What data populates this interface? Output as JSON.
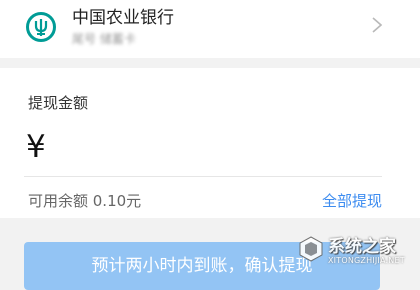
{
  "bank_card": {
    "name": "中国农业银行",
    "subtitle": "尾号 储蓄卡",
    "brand_color": "#009c96"
  },
  "withdraw": {
    "title": "提现金额",
    "currency_symbol": "¥",
    "amount_value": "",
    "available_text": "可用余额 0.10元",
    "withdraw_all_label": "全部提现",
    "link_color": "#3d8cf0"
  },
  "confirm_button": {
    "label": "预计两小时内到账，确认提现",
    "color": "#93c4f4"
  },
  "watermark": {
    "text": "系统之家",
    "subtext": "XITONGZHIJIA.NET"
  }
}
